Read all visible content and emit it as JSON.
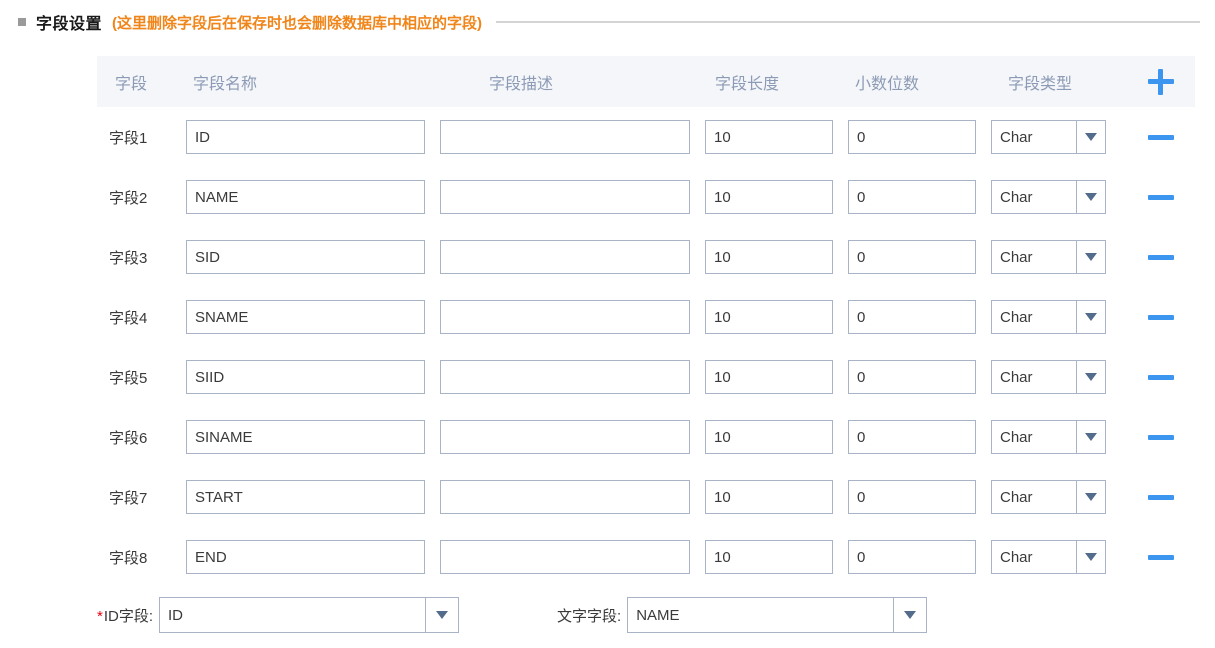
{
  "section": {
    "title": "字段设置",
    "note": "(这里删除字段后在保存时也会删除数据库中相应的字段)",
    "bullet_color": "#9a9a9a",
    "note_color": "#f08519"
  },
  "table": {
    "headers": {
      "index": "字段",
      "name": "字段名称",
      "description": "字段描述",
      "length": "字段长度",
      "decimals": "小数位数",
      "type": "字段类型",
      "add_icon": "plus-icon"
    },
    "header_bg": "#f5f6fa",
    "header_text_color": "#8c9bb5",
    "accent_color": "#3c96f0",
    "rows": [
      {
        "label": "字段1",
        "name": "ID",
        "description": "",
        "length": "10",
        "decimals": "0",
        "type": "Char",
        "remove_icon": "minus-icon"
      },
      {
        "label": "字段2",
        "name": "NAME",
        "description": "",
        "length": "10",
        "decimals": "0",
        "type": "Char",
        "remove_icon": "minus-icon"
      },
      {
        "label": "字段3",
        "name": "SID",
        "description": "",
        "length": "10",
        "decimals": "0",
        "type": "Char",
        "remove_icon": "minus-icon"
      },
      {
        "label": "字段4",
        "name": "SNAME",
        "description": "",
        "length": "10",
        "decimals": "0",
        "type": "Char",
        "remove_icon": "minus-icon"
      },
      {
        "label": "字段5",
        "name": "SIID",
        "description": "",
        "length": "10",
        "decimals": "0",
        "type": "Char",
        "remove_icon": "minus-icon"
      },
      {
        "label": "字段6",
        "name": "SINAME",
        "description": "",
        "length": "10",
        "decimals": "0",
        "type": "Char",
        "remove_icon": "minus-icon"
      },
      {
        "label": "字段7",
        "name": "START",
        "description": "",
        "length": "10",
        "decimals": "0",
        "type": "Char",
        "remove_icon": "minus-icon"
      },
      {
        "label": "字段8",
        "name": "END",
        "description": "",
        "length": "10",
        "decimals": "0",
        "type": "Char",
        "remove_icon": "minus-icon"
      }
    ]
  },
  "bottom": {
    "id_field": {
      "required_marker": "*",
      "label": "ID字段:",
      "value": "ID"
    },
    "text_field": {
      "label": "文字字段:",
      "value": "NAME"
    }
  }
}
